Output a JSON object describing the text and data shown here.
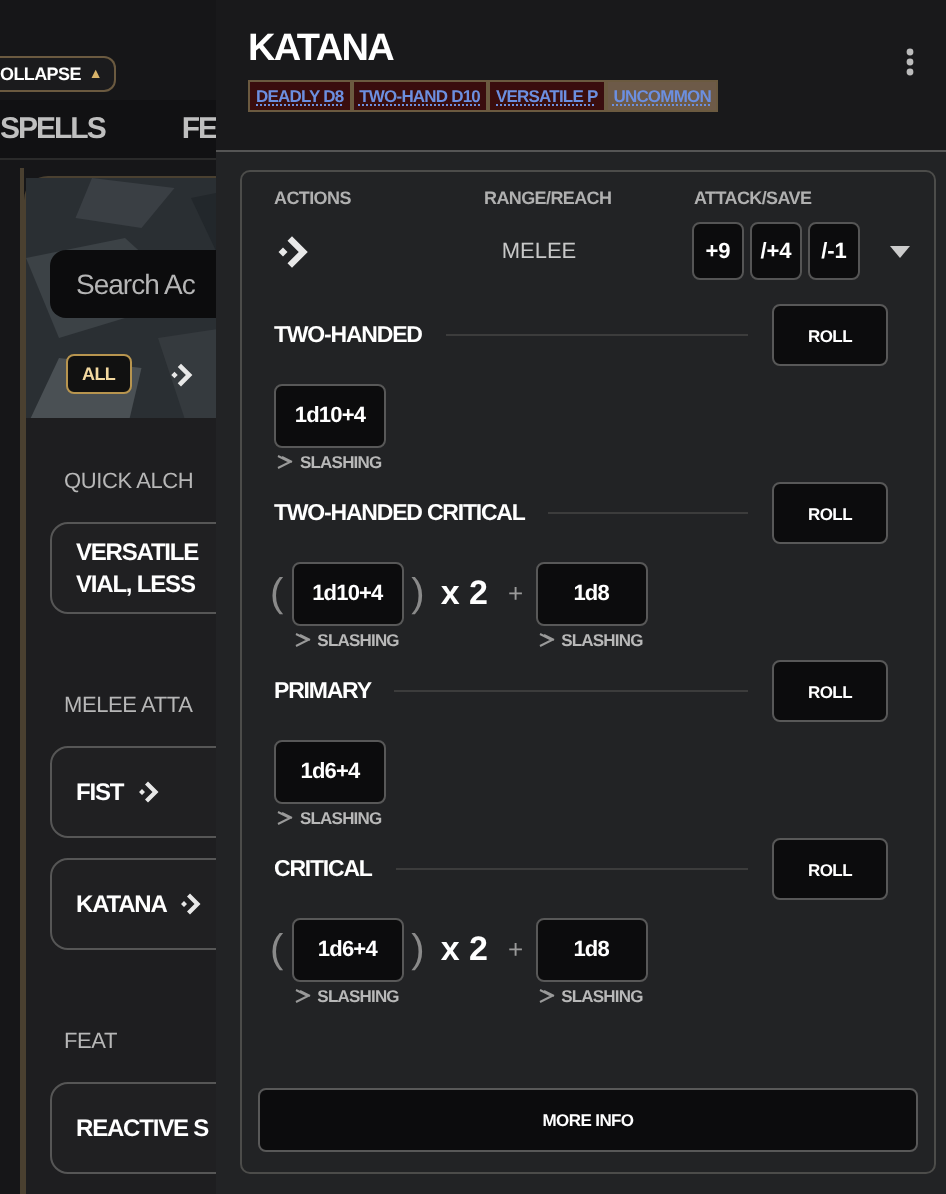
{
  "background": {
    "collapse_button": {
      "label": "OLLAPSE",
      "icon": "▲"
    },
    "tabs": [
      {
        "label": "SPELLS",
        "selected": false
      },
      {
        "label": "FE",
        "selected": false
      }
    ],
    "search": {
      "placeholder": "Search Ac"
    },
    "filter_chip": {
      "label": "ALL",
      "selected": true
    },
    "sections": [
      {
        "title": "QUICK ALCH",
        "cards": [
          {
            "label": "VERSATILE\nVIAL, LESS"
          }
        ]
      },
      {
        "title": "MELEE ATTA",
        "cards": [
          {
            "label": "FIST",
            "action": true
          },
          {
            "label": "KATANA",
            "action": true
          }
        ]
      },
      {
        "title": "FEAT",
        "cards": [
          {
            "label": "REACTIVE S"
          }
        ]
      }
    ]
  },
  "drawer": {
    "title": "KATANA",
    "traits": [
      {
        "label": "DEADLY D8",
        "kind": "trait"
      },
      {
        "label": "TWO-HAND D10",
        "kind": "trait"
      },
      {
        "label": "VERSATILE P",
        "kind": "trait"
      },
      {
        "label": "UNCOMMON",
        "kind": "rarity"
      }
    ],
    "columns": [
      "ACTIONS",
      "RANGE/REACH",
      "ATTACK/SAVE"
    ],
    "range": "MELEE",
    "attacks": [
      "+9",
      "/+4",
      "/-1"
    ],
    "damage": [
      {
        "title": "TWO-HANDED",
        "kind": "simple",
        "roll": "ROLL",
        "dice": [
          {
            "value": "1d10+4",
            "type": "SLASHING"
          }
        ]
      },
      {
        "title": "TWO-HANDED CRITICAL",
        "kind": "critical",
        "roll": "ROLL",
        "open": "(",
        "close": ")",
        "multiplier": "x 2",
        "plus": "+",
        "dice": [
          {
            "value": "1d10+4",
            "type": "SLASHING"
          },
          {
            "value": "1d8",
            "type": "SLASHING"
          }
        ]
      },
      {
        "title": "PRIMARY",
        "kind": "simple",
        "roll": "ROLL",
        "dice": [
          {
            "value": "1d6+4",
            "type": "SLASHING"
          }
        ]
      },
      {
        "title": "CRITICAL",
        "kind": "critical",
        "roll": "ROLL",
        "open": "(",
        "close": ")",
        "multiplier": "x 2",
        "plus": "+",
        "dice": [
          {
            "value": "1d6+4",
            "type": "SLASHING"
          },
          {
            "value": "1d8",
            "type": "SLASHING"
          }
        ]
      }
    ],
    "more_info": "MORE INFO"
  }
}
